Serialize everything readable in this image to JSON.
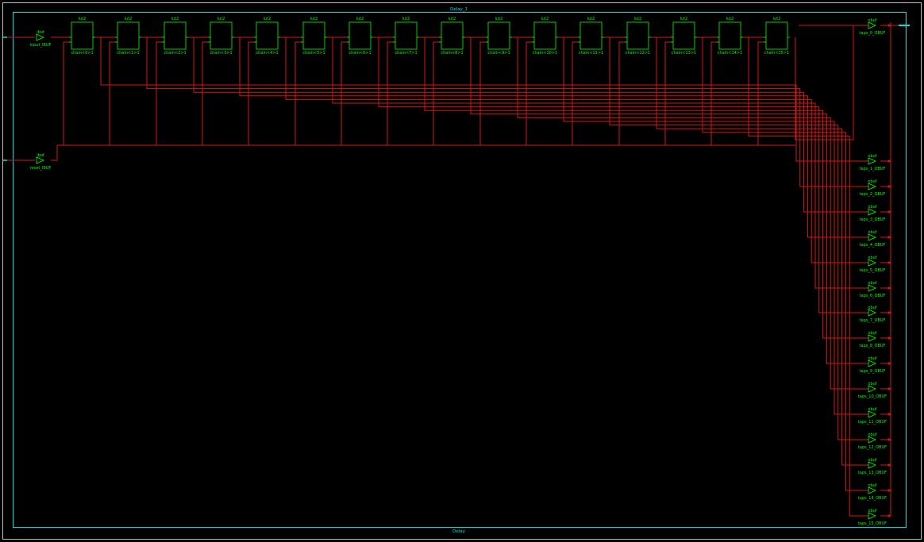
{
  "design": {
    "title_top": "Delay_1",
    "title_bottom": "Delay",
    "colors": {
      "background": "#000000",
      "frame": "#c0c0c0",
      "module_border": "#00e0e0",
      "cell": "#00ff00",
      "wire": "#d01818"
    }
  },
  "input_buffers": [
    {
      "type": "ibuf",
      "name": "input_IBUF"
    },
    {
      "type": "ibuf",
      "name": "reset_IBUF"
    }
  ],
  "chain_cells": [
    {
      "type": "lut2",
      "name": "chain<0>1"
    },
    {
      "type": "lut2",
      "name": "chain<1>1"
    },
    {
      "type": "lut2",
      "name": "chain<2>1"
    },
    {
      "type": "lut2",
      "name": "chain<3>1"
    },
    {
      "type": "lut2",
      "name": "chain<4>1"
    },
    {
      "type": "lut2",
      "name": "chain<5>1"
    },
    {
      "type": "lut2",
      "name": "chain<6>1"
    },
    {
      "type": "lut2",
      "name": "chain<7>1"
    },
    {
      "type": "lut2",
      "name": "chain<8>1"
    },
    {
      "type": "lut2",
      "name": "chain<9>1"
    },
    {
      "type": "lut2",
      "name": "chain<10>1"
    },
    {
      "type": "lut2",
      "name": "chain<11>1"
    },
    {
      "type": "lut2",
      "name": "chain<12>1"
    },
    {
      "type": "lut2",
      "name": "chain<13>1"
    },
    {
      "type": "lut2",
      "name": "chain<14>1"
    },
    {
      "type": "lut2",
      "name": "chain<15>1"
    }
  ],
  "output_buffers": [
    {
      "type": "obuf",
      "name": "taps_0_OBUF"
    },
    {
      "type": "obuf",
      "name": "taps_1_OBUF"
    },
    {
      "type": "obuf",
      "name": "taps_2_OBUF"
    },
    {
      "type": "obuf",
      "name": "taps_3_OBUF"
    },
    {
      "type": "obuf",
      "name": "taps_4_OBUF"
    },
    {
      "type": "obuf",
      "name": "taps_5_OBUF"
    },
    {
      "type": "obuf",
      "name": "taps_6_OBUF"
    },
    {
      "type": "obuf",
      "name": "taps_7_OBUF"
    },
    {
      "type": "obuf",
      "name": "taps_8_OBUF"
    },
    {
      "type": "obuf",
      "name": "taps_9_OBUF"
    },
    {
      "type": "obuf",
      "name": "taps_10_OBUF"
    },
    {
      "type": "obuf",
      "name": "taps_11_OBUF"
    },
    {
      "type": "obuf",
      "name": "taps_12_OBUF"
    },
    {
      "type": "obuf",
      "name": "taps_13_OBUF"
    },
    {
      "type": "obuf",
      "name": "taps_14_OBUF"
    },
    {
      "type": "obuf",
      "name": "taps_15_OBUF"
    }
  ]
}
